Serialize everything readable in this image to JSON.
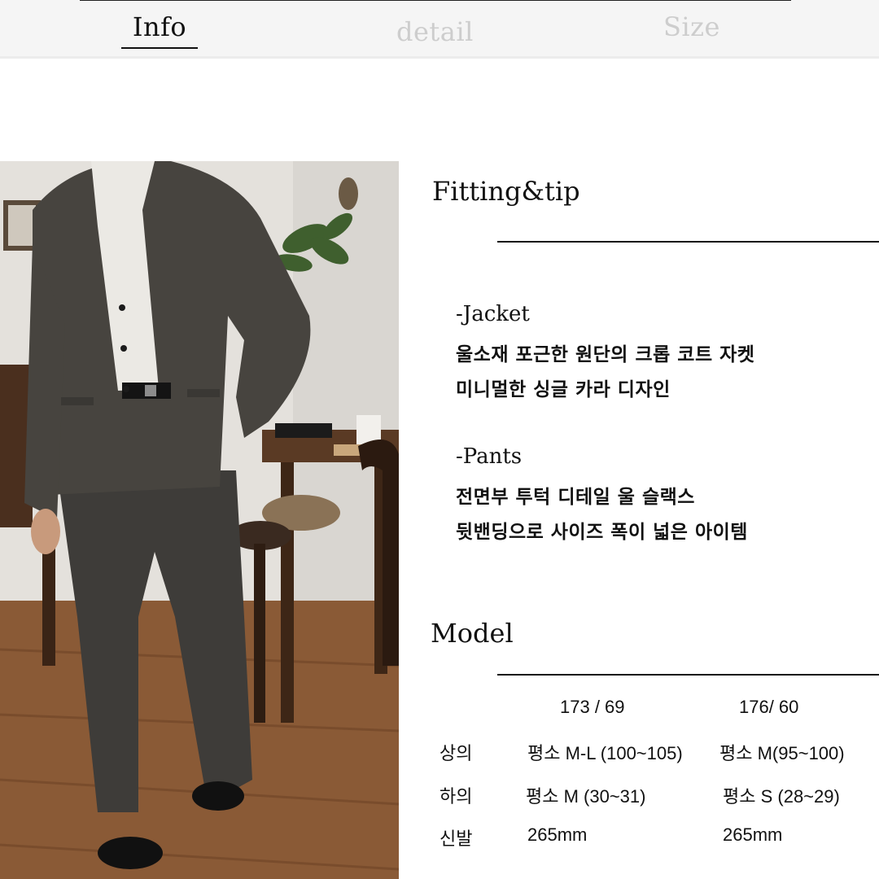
{
  "tabs": {
    "info": "Info",
    "detail": "detail",
    "size": "Size"
  },
  "photo": {
    "description_icon": "model-photo"
  },
  "fitting": {
    "title": "Fitting&tip",
    "jacket_head": "-Jacket",
    "jacket_line1": "울소재 포근한 원단의 크롭 코트 자켓",
    "jacket_line2": "미니멀한 싱글 카라 디자인",
    "pants_head": "-Pants",
    "pants_line1": "전면부 투턱 디테일 울 슬랙스",
    "pants_line2": "뒷밴딩으로 사이즈 폭이 넓은 아이템"
  },
  "model": {
    "title": "Model",
    "columns": [
      "173 / 69",
      "176/ 60"
    ],
    "rows": [
      {
        "label": "상의",
        "a": "평소 M-L (100~105)",
        "b": "평소 M(95~100)"
      },
      {
        "label": "하의",
        "a": "평소 M (30~31)",
        "b": "평소 S (28~29)"
      },
      {
        "label": "신발",
        "a": "265mm",
        "b": "265mm"
      }
    ]
  },
  "colors": {
    "tab_active": "#111111",
    "tab_inactive": "#cdcdcd",
    "tabbar_bg": "#f5f5f5"
  }
}
